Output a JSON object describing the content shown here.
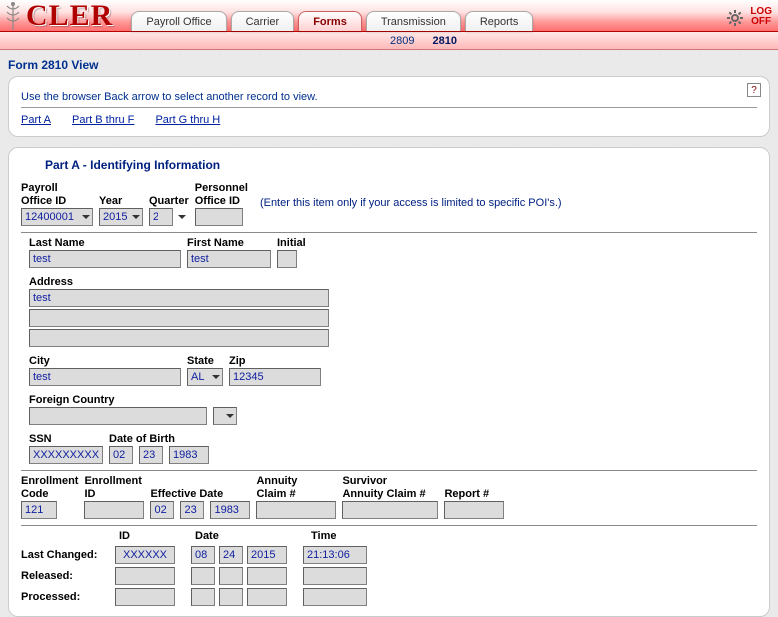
{
  "app": {
    "logo": "CLER",
    "logoff1": "LOG",
    "logoff2": "OFF"
  },
  "tabs": {
    "payroll": "Payroll Office",
    "carrier": "Carrier",
    "forms": "Forms",
    "transmission": "Transmission",
    "reports": "Reports"
  },
  "subtabs": {
    "a": "2809",
    "b": "2810"
  },
  "page_title": "Form 2810 View",
  "top_card": {
    "note": "Use the browser Back arrow to select another record to view.",
    "link_a": "Part A",
    "link_bf": "Part B thru F",
    "link_gh": "Part G thru H",
    "help": "?"
  },
  "section_title": "Part A - Identifying Information",
  "labels": {
    "payroll_office_id_1": "Payroll",
    "payroll_office_id_2": "Office ID",
    "year": "Year",
    "quarter": "Quarter",
    "personnel_1": "Personnel",
    "personnel_2": "Office ID",
    "poi_hint": "(Enter this item only if your access is limited to specific POI's.)",
    "last_name": "Last Name",
    "first_name": "First Name",
    "initial": "Initial",
    "address": "Address",
    "city": "City",
    "state": "State",
    "zip": "Zip",
    "foreign": "Foreign Country",
    "ssn": "SSN",
    "dob": "Date of Birth",
    "enroll_code_1": "Enrollment",
    "enroll_code_2": "Code",
    "enroll_id_1": "Enrollment",
    "enroll_id_2": "ID",
    "eff_date": "Effective Date",
    "annuity_1": "Annuity",
    "annuity_2": "Claim #",
    "survivor_1": "Survivor",
    "survivor_2": "Annuity Claim #",
    "report": "Report #",
    "id": "ID",
    "date": "Date",
    "time": "Time",
    "last_changed": "Last Changed:",
    "released": "Released:",
    "processed": "Processed:"
  },
  "values": {
    "payroll_office_id": "12400001",
    "year": "2015",
    "quarter": "2",
    "personnel_office_id": "",
    "last_name": "test",
    "first_name": "test",
    "initial": "",
    "address1": "test",
    "address2": "",
    "address3": "",
    "city": "test",
    "state": "AL",
    "zip": "12345",
    "foreign": "",
    "ssn": "XXXXXXXXX",
    "dob_mm": "02",
    "dob_dd": "23",
    "dob_yyyy": "1983",
    "enroll_code": "121",
    "enroll_id": "",
    "eff_mm": "02",
    "eff_dd": "23",
    "eff_yyyy": "1983",
    "annuity": "",
    "survivor": "",
    "report": "",
    "lc_id": "XXXXXX",
    "lc_mm": "08",
    "lc_dd": "24",
    "lc_yyyy": "2015",
    "lc_time": "21:13:06"
  }
}
